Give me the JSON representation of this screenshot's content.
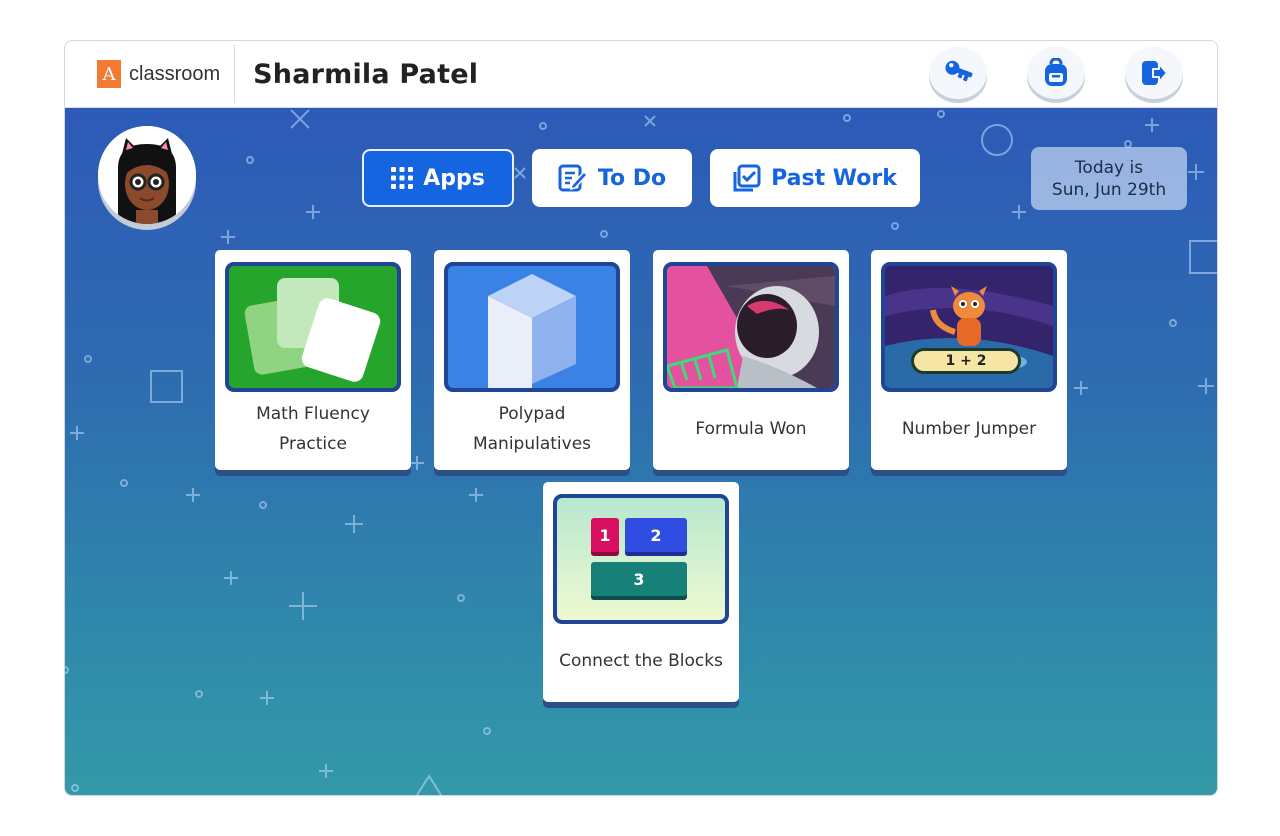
{
  "header": {
    "logo_letter": "A",
    "logo_text": "classroom",
    "student_name": "Sharmila Patel",
    "icons": [
      "key-icon",
      "backpack-icon",
      "sign-out-icon"
    ]
  },
  "nav": {
    "apps_label": "Apps",
    "todo_label": "To Do",
    "past_work_label": "Past Work",
    "active": "Apps"
  },
  "date": {
    "line1": "Today is",
    "line2": "Sun, Jun 29th"
  },
  "apps": [
    {
      "label": "Math Fluency Practice"
    },
    {
      "label": "Polypad Manipulatives"
    },
    {
      "label": "Formula Won"
    },
    {
      "label": "Number Jumper",
      "badge": "1 + 2"
    },
    {
      "label": "Connect the Blocks",
      "blocks": [
        "1",
        "2",
        "3"
      ]
    }
  ],
  "colors": {
    "accent": "#1565e0",
    "background_top": "#2d5ab8",
    "background_bottom": "#3399a8",
    "card_border": "#1e4596",
    "logo": "#f27b32"
  }
}
